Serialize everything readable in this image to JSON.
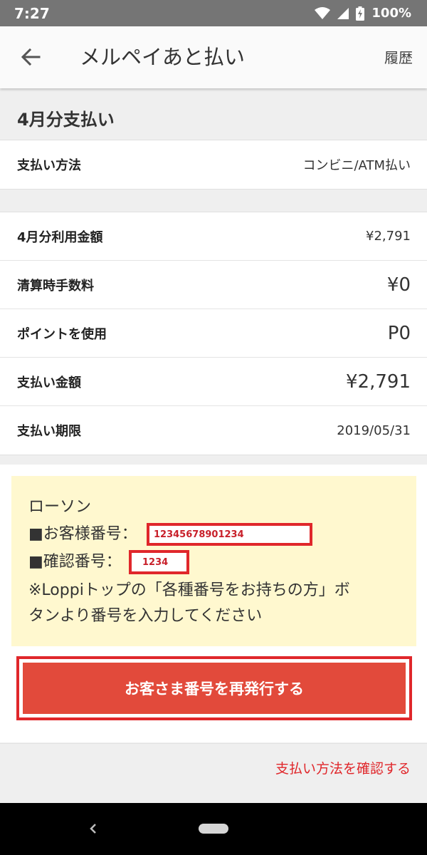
{
  "status_bar": {
    "time": "7:27",
    "battery": "100%",
    "icons": [
      "wifi-icon",
      "signal-icon",
      "battery-icon"
    ]
  },
  "app_bar": {
    "title": "メルペイあと払い",
    "history_label": "履歴",
    "back_icon": "arrow-left-icon"
  },
  "section": {
    "title": "4月分支払い"
  },
  "payment_method": {
    "label": "支払い方法",
    "value": "コンビニ/ATM払い"
  },
  "details": [
    {
      "label": "4月分利用金額",
      "value": "¥2,791"
    },
    {
      "label": "清算時手数料",
      "value": "¥0"
    },
    {
      "label": "ポイントを使用",
      "value": "P0"
    },
    {
      "label": "支払い金額",
      "value": "¥2,791"
    },
    {
      "label": "支払い期限",
      "value": "2019/05/31"
    }
  ],
  "notice": {
    "store": "ローソン",
    "customer_number_label": "■お客様番号：",
    "customer_number": "12345678901234",
    "confirm_number_label": "■確認番号：",
    "confirm_number": "1234",
    "instruction_line1": "※Loppiトップの「各種番号をお持ちの方」ボ",
    "instruction_line2": "タンより番号を入力してください"
  },
  "reissue_button": {
    "label": "お客さま番号を再発行する"
  },
  "footer": {
    "confirm_link": "支払い方法を確認する"
  },
  "colors": {
    "accent_red": "#e0272b",
    "button_red": "#e24a3b",
    "notice_bg": "#fff8cf",
    "status_bar_bg": "#757575"
  }
}
